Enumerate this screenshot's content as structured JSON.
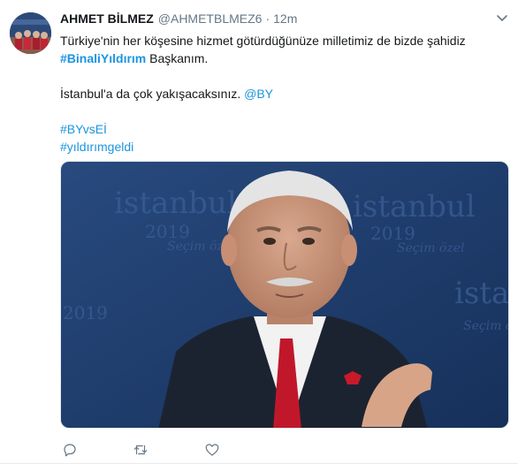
{
  "tweet": {
    "author_name": "AHMET BİLMEZ",
    "author_handle": "@AHMETBLMEZ6",
    "separator": "·",
    "time": "12m",
    "text_line1": "Türkiye'nin her köşesine hizmet götürdüğünüze milletimiz de bizde  şahidiz",
    "hashtag_binali": "#BinaliYıldırım",
    "text_line2_suffix": " Başkanım.",
    "text_istanbul": "İstanbul'a da çok yakışacaksınız. ",
    "mention": "@BY",
    "hashtag_1": "#BYvsEİ",
    "hashtag_2": "#yıldırımgeldi"
  },
  "media": {
    "backdrop_city": "istanbul",
    "backdrop_year": "2019",
    "backdrop_tagline": "Seçim özel"
  },
  "actions": {
    "reply_icon": "reply-icon",
    "retweet_icon": "retweet-icon",
    "like_icon": "heart-icon"
  },
  "colors": {
    "link": "#1b95e0",
    "muted": "#657786",
    "backdrop": "#1f3a66"
  }
}
